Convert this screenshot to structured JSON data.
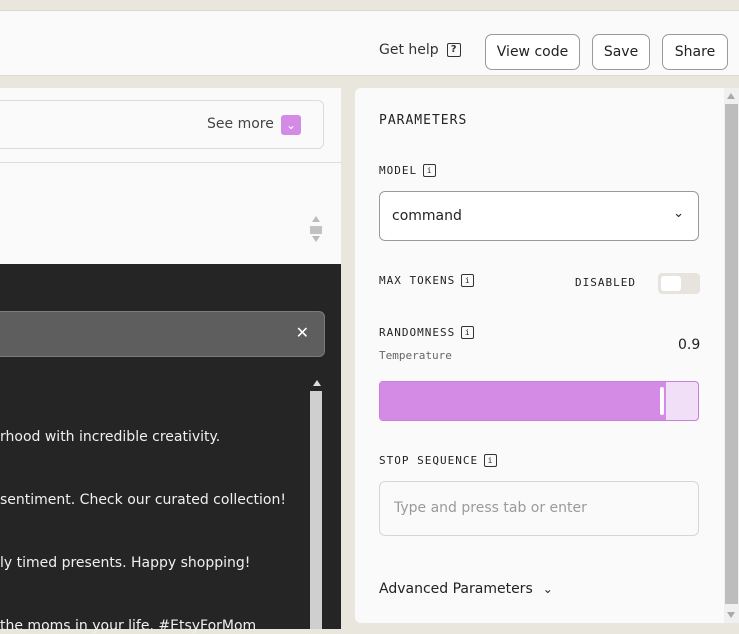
{
  "header": {
    "help_label": "Get help",
    "help_icon": "?",
    "view_code_label": "View code",
    "save_label": "Save",
    "share_label": "Share"
  },
  "examples": {
    "see_more_label": "See more"
  },
  "output": {
    "lines": [
      "rhood with incredible creativity.",
      "sentiment. Check our curated collection!",
      "ly timed presents. Happy shopping!",
      "the moms in your life. #EtsyForMom"
    ]
  },
  "parameters": {
    "title": "PARAMETERS",
    "model": {
      "label": "MODEL",
      "value": "command"
    },
    "max_tokens": {
      "label": "MAX TOKENS",
      "state_label": "DISABLED",
      "enabled": false
    },
    "randomness": {
      "label": "RANDOMNESS",
      "sublabel": "Temperature",
      "value": "0.9",
      "level": 0.9
    },
    "stop_sequence": {
      "label": "STOP SEQUENCE",
      "placeholder": "Type and press tab or enter"
    },
    "advanced_label": "Advanced Parameters"
  },
  "colors": {
    "accent": "#d38be6",
    "accent_light": "#f1dff7",
    "background": "#e9e6dd",
    "output_bg": "#252525"
  }
}
